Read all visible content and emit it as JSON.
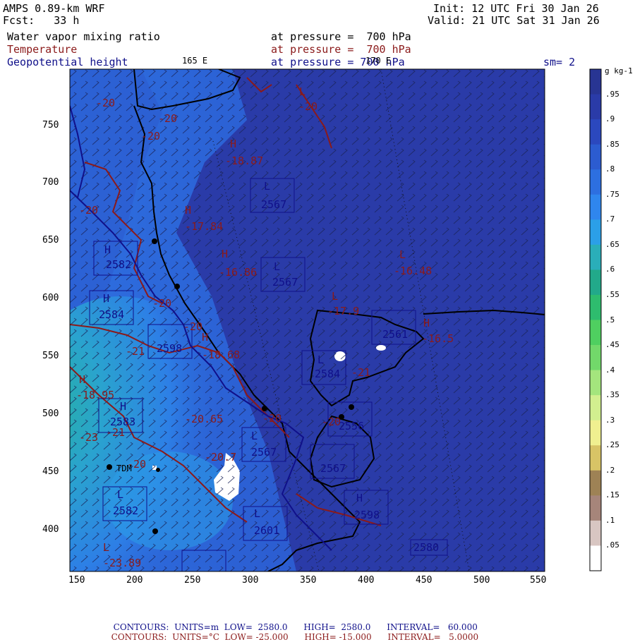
{
  "header": {
    "model": "AMPS 0.89-km WRF",
    "init": "Init: 12 UTC Fri 30 Jan 26",
    "forecast": "Fcst:   33 h",
    "valid": "Valid: 21 UTC Sat 31 Jan 26",
    "smoothing": "sm= 2"
  },
  "fields": [
    {
      "name": "Water vapor mixing ratio",
      "level": "at pressure =  700 hPa",
      "color": "#000000"
    },
    {
      "name": "Temperature",
      "level": "at pressure =  700 hPa",
      "color": "#8b1a1a"
    },
    {
      "name": "Geopotential height",
      "level": "at pressure = 700 hPa",
      "color": "#10108a"
    }
  ],
  "map": {
    "lon_labels": [
      "165 E",
      "170 E"
    ],
    "x_ticks": [
      "150",
      "200",
      "250",
      "300",
      "350",
      "400",
      "450",
      "500",
      "550"
    ],
    "y_ticks": [
      "750",
      "700",
      "650",
      "600",
      "550",
      "500",
      "450",
      "400"
    ],
    "station_label": "TDM",
    "temp_labels": [
      "-20",
      "-20",
      "-20",
      "-20",
      "-20",
      "-18.87",
      "-17.84",
      "-16.86",
      "-16.48",
      "-17.9",
      "-16.5",
      "-18.68",
      "-21",
      "-18.95",
      "-20.65",
      "-20",
      "-20",
      "-20.7",
      "-20",
      "-21",
      "-23.89",
      "-23",
      "-21",
      "-20",
      "-20"
    ],
    "height_labels": [
      "2567",
      "2567",
      "2582",
      "2584",
      "2598",
      "2584",
      "2583",
      "2567",
      "2561",
      "2556",
      "2567",
      "2582",
      "2598",
      "2601",
      "2580"
    ],
    "max_min_markers": [
      "H",
      "H",
      "H",
      "H",
      "H",
      "H",
      "H",
      "H",
      "H",
      "H",
      "L",
      "L",
      "L",
      "L",
      "L",
      "L",
      "L",
      "L",
      "L",
      "L"
    ]
  },
  "colorbar": {
    "units": "g kg-1",
    "labels": [
      ".95",
      ".9",
      ".85",
      ".8",
      ".75",
      ".7",
      ".65",
      ".6",
      ".55",
      ".5",
      ".45",
      ".4",
      ".35",
      ".3",
      ".25",
      ".2",
      ".15",
      ".1",
      ".05"
    ],
    "colors": [
      "#283593",
      "#2a3ba8",
      "#2b48be",
      "#2c5cd0",
      "#2d6fe0",
      "#2f86ee",
      "#2b9fe8",
      "#2aaeb9",
      "#22a98a",
      "#2ebc6e",
      "#4fcf60",
      "#72d86a",
      "#a4e57d",
      "#d2ef8f",
      "#f0f090",
      "#d8c466",
      "#9e8255",
      "#a6857a",
      "#d8c6c2",
      "#ffffff"
    ]
  },
  "footer": {
    "line1": {
      "label": "CONTOURS:",
      "units": "UNITS=m",
      "low": "LOW=  2580.0",
      "high": "HIGH=  2580.0",
      "interval": "INTERVAL=   60.000",
      "color": "#10108a"
    },
    "line2": {
      "label": "CONTOURS:",
      "units": "UNITS=°C",
      "low": "LOW= -25.000",
      "high": "HIGH= -15.000",
      "interval": "INTERVAL=   5.0000",
      "color": "#8b1a1a"
    }
  }
}
